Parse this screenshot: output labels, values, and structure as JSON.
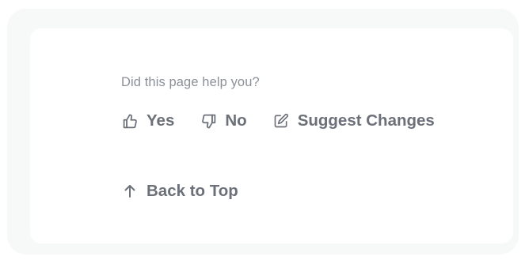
{
  "feedback": {
    "question": "Did this page help you?",
    "yes_label": "Yes",
    "yes_icon": "thumbs-up-icon",
    "no_label": "No",
    "no_icon": "thumbs-down-icon",
    "suggest_label": "Suggest Changes",
    "suggest_icon": "edit-icon"
  },
  "navigation": {
    "back_to_top_label": "Back to Top",
    "back_to_top_icon": "arrow-up-icon"
  },
  "colors": {
    "frame_background": "#f7f8f8",
    "card_background": "#ffffff",
    "question_text": "#8b9098",
    "action_text": "#6b7079"
  }
}
